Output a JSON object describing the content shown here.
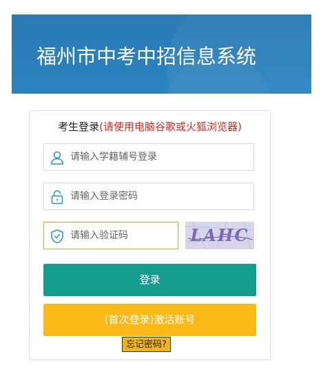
{
  "header": {
    "title": "福州市中考中招信息系统"
  },
  "login": {
    "title_prefix": "考生登录",
    "title_note": "(请使用电脑谷歌或火狐浏览器)",
    "username": {
      "placeholder": "请输入学籍辅号登录",
      "icon": "user-icon"
    },
    "password": {
      "placeholder": "请输入登录密码",
      "icon": "lock-icon"
    },
    "captcha": {
      "placeholder": "请输入验证码",
      "icon": "shield-icon",
      "image_text": "LAHC"
    },
    "login_button": "登录",
    "activate_button": "(首次登录)激活账号",
    "forgot_link": "忘记密码?"
  },
  "colors": {
    "banner": "#2a7fbb",
    "login_button": "#139d8e",
    "activate_button": "#fbb917",
    "warning_text": "#e1251b",
    "icon": "#2a8fc7",
    "captcha_field_border": "#e0a22a"
  }
}
